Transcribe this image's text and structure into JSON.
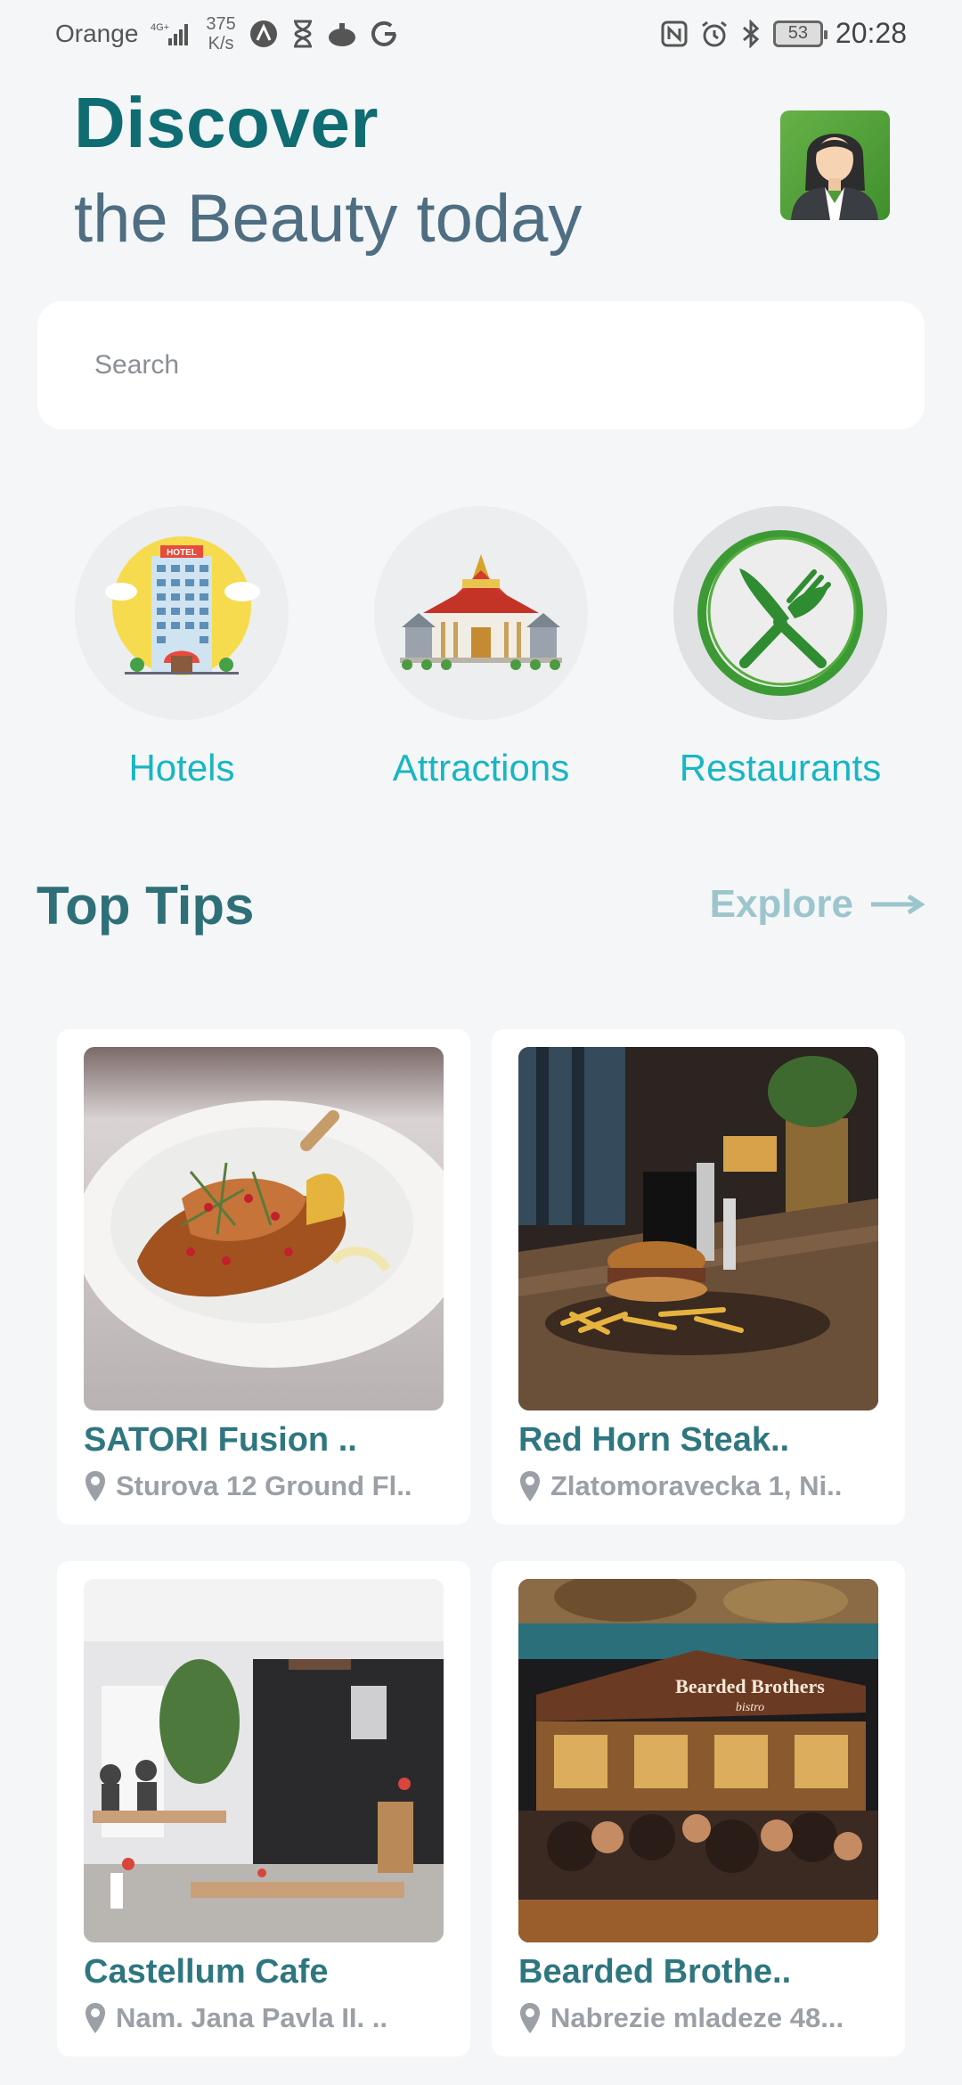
{
  "status_bar": {
    "carrier": "Orange",
    "network_type": "4G+",
    "speed_value": "375",
    "speed_unit": "K/s",
    "battery": "53",
    "time": "20:28"
  },
  "header": {
    "title": "Discover",
    "subtitle": "the Beauty today"
  },
  "search": {
    "placeholder": "Search"
  },
  "categories": [
    {
      "label": "Hotels"
    },
    {
      "label": "Attractions"
    },
    {
      "label": "Restaurants"
    }
  ],
  "top_tips": {
    "title": "Top Tips",
    "explore_label": "Explore"
  },
  "places": [
    {
      "name": "SATORI Fusion ..",
      "address": "Sturova 12 Ground Fl.."
    },
    {
      "name": "Red Horn Steak..",
      "address": "Zlatomoravecka 1, Ni.."
    },
    {
      "name": "Castellum Cafe",
      "address": "Nam. Jana Pavla II. .."
    },
    {
      "name": "Bearded Brothe..",
      "address": "Nabrezie mladeze 48..."
    }
  ],
  "photo_texts": {
    "bearded_sign": "Bearded Brothers",
    "bearded_sign_sub": "bistro"
  },
  "colors": {
    "title": "#0f6c72",
    "subtitle": "#4f6e82",
    "category": "#18b6c2",
    "card_title": "#2f7780",
    "address": "#9aa0a6",
    "explore": "#9cc5cc",
    "background": "#f4f6f8"
  }
}
